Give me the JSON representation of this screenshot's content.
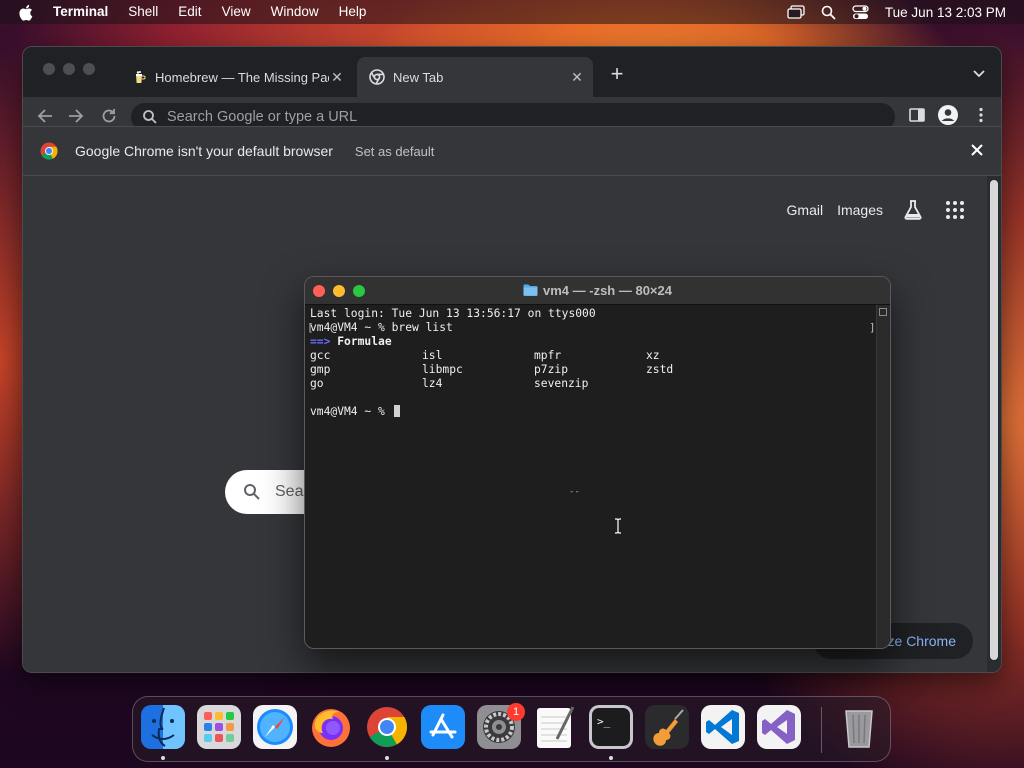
{
  "menubar": {
    "app_name": "Terminal",
    "items": [
      "Shell",
      "Edit",
      "View",
      "Window",
      "Help"
    ],
    "clock": "Tue Jun 13  2:03 PM"
  },
  "chrome": {
    "tabs": [
      {
        "title": "Homebrew — The Missing Package Manager for macOS",
        "active": false
      },
      {
        "title": "New Tab",
        "active": true
      }
    ],
    "omnibox_placeholder": "Search Google or type a URL",
    "infobar": {
      "message": "Google Chrome isn't your default browser",
      "action": "Set as default"
    },
    "ntp": {
      "links": [
        "Gmail",
        "Images"
      ],
      "search_placeholder": "Sea",
      "customize_label": "ize Chrome"
    }
  },
  "terminal": {
    "title": "vm4 — -zsh — 80×24",
    "last_login": "Last login: Tue Jun 13 13:56:17 on ttys000",
    "prompt1": "vm4@VM4 ~ % brew list",
    "section_arrow": "==>",
    "section_title": "Formulae",
    "formulae_rows": [
      [
        "gcc",
        "isl",
        "mpfr",
        "xz"
      ],
      [
        "gmp",
        "libmpc",
        "p7zip",
        "zstd"
      ],
      [
        "go",
        "lz4",
        "sevenzip",
        ""
      ]
    ],
    "prompt2": "vm4@VM4 ~ % ",
    "stray_mark": "--"
  },
  "dock": {
    "apps": [
      "Finder",
      "Launchpad",
      "Safari",
      "Firefox",
      "Google Chrome",
      "App Store",
      "System Settings",
      "TextEdit",
      "Terminal",
      "GarageBand",
      "Visual Studio Code",
      "Visual Studio",
      "Trash"
    ],
    "settings_badge": "1"
  }
}
